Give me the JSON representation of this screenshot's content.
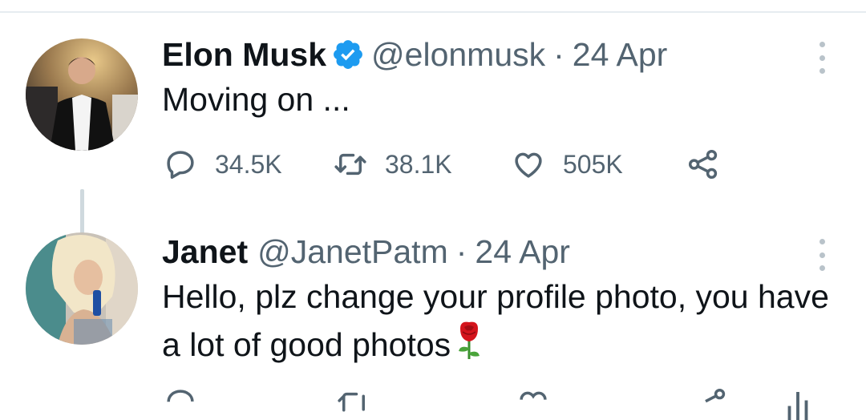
{
  "tweets": [
    {
      "author": {
        "name": "Elon Musk",
        "verified": true,
        "handle": "@elonmusk"
      },
      "separator": "·",
      "date": "24 Apr",
      "text": "Moving on ...",
      "stats": {
        "replies": "34.5K",
        "retweets": "38.1K",
        "likes": "505K"
      }
    },
    {
      "author": {
        "name": "Janet",
        "verified": false,
        "handle": "@JanetPatm"
      },
      "separator": "·",
      "date": "24 Apr",
      "text": "Hello, plz change your profile photo, you have a lot of good photos",
      "emoji": "rose"
    }
  ],
  "colors": {
    "text_primary": "#0f1419",
    "text_secondary": "#536471",
    "verified_blue": "#1d9bf0",
    "thread_line": "#cfd9de"
  },
  "icons": [
    "verified-badge-icon",
    "more-options-icon",
    "reply-icon",
    "retweet-icon",
    "like-icon",
    "share-icon",
    "analytics-icon",
    "rose-emoji-icon"
  ]
}
